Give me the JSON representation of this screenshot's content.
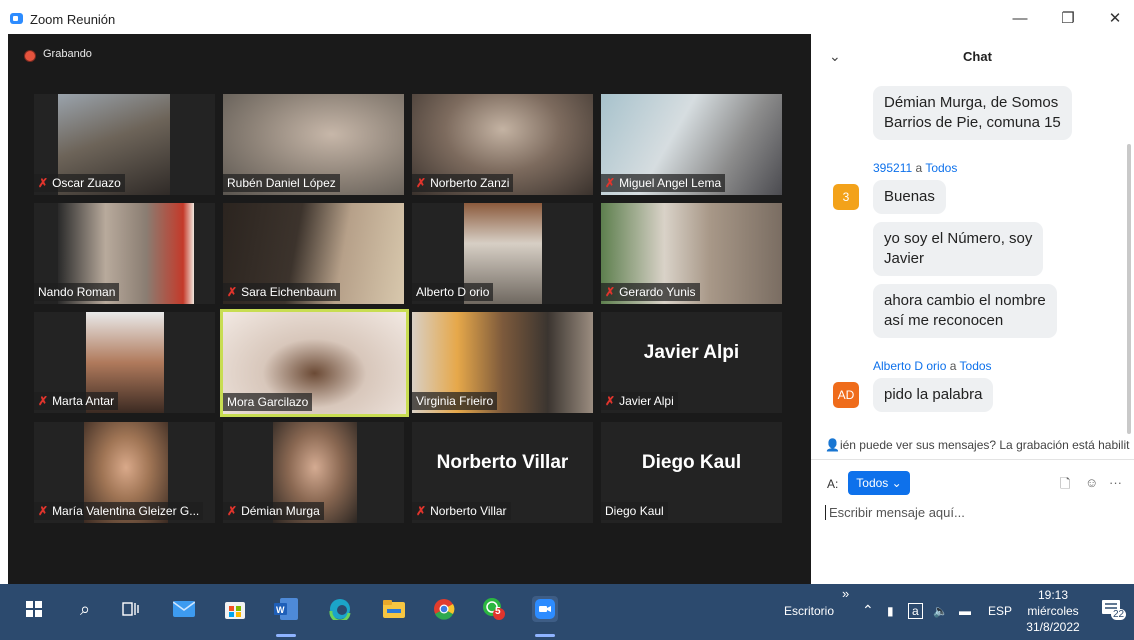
{
  "window": {
    "title": "Zoom Reunión",
    "minimize": "—",
    "maximize": "❐",
    "close": "✕"
  },
  "recording": {
    "label": "Grabando"
  },
  "participants": [
    {
      "name": "Oscar Zuazo",
      "muted": true
    },
    {
      "name": "Rubén Daniel López",
      "muted": false
    },
    {
      "name": "Norberto Zanzi",
      "muted": true
    },
    {
      "name": "Miguel Angel Lema",
      "muted": true
    },
    {
      "name": "Nando Roman",
      "muted": false
    },
    {
      "name": "Sara Eichenbaum",
      "muted": true
    },
    {
      "name": "Alberto D orio",
      "muted": false
    },
    {
      "name": "Gerardo Yunis",
      "muted": true
    },
    {
      "name": "Marta Antar",
      "muted": true
    },
    {
      "name": "Mora Garcilazo",
      "muted": false,
      "active": true
    },
    {
      "name": "Virginia Frieiro",
      "muted": false
    },
    {
      "name": "Javier Alpi",
      "muted": true,
      "big": "Javier Alpi"
    },
    {
      "name": "María Valentina Gleizer G...",
      "muted": true
    },
    {
      "name": "Démian Murga",
      "muted": true
    },
    {
      "name": "Norberto Villar",
      "muted": true,
      "big": "Norberto Villar"
    },
    {
      "name": "Diego Kaul",
      "muted": false,
      "big": "Diego Kaul"
    }
  ],
  "chat": {
    "title": "Chat",
    "collapse_icon": "chevron-down-icon",
    "messages": [
      {
        "text_line1": "Démian Murga, de Somos",
        "text_line2": "Barrios de Pie, comuna 15"
      },
      {
        "sender": "395211",
        "to_word": "a",
        "recipient": "Todos",
        "avatar": "3",
        "avatar_color": "#f3a21a",
        "text": "Buenas"
      },
      {
        "text_line1": "yo soy el Número, soy",
        "text_line2": "Javier"
      },
      {
        "text_line1": "ahora cambio el nombre",
        "text_line2": "así me reconocen"
      },
      {
        "sender": "Alberto D orio",
        "to_word": "a",
        "recipient": "Todos",
        "avatar": "AD",
        "avatar_color": "#ef6c1b",
        "text": "pido la palabra"
      }
    ],
    "notice": "ién puede ver sus mensajes? La grabación está habilit",
    "to_label": "A:",
    "to_value": "Todos ⌄",
    "input_placeholder": "Escribir mensaje aquí...",
    "more": "···"
  },
  "taskbar": {
    "desktop_label": "Escritorio",
    "chevron": "»",
    "lang": "ESP",
    "time": "19:13",
    "day": "miércoles",
    "date": "31/8/2022",
    "whatsapp_badge": "5",
    "notif_count": "22"
  },
  "colors": {
    "accent": "#0e71eb",
    "active_speaker": "#c8dd52",
    "taskbar": "#2c4a6e",
    "mute": "#e0342c"
  }
}
